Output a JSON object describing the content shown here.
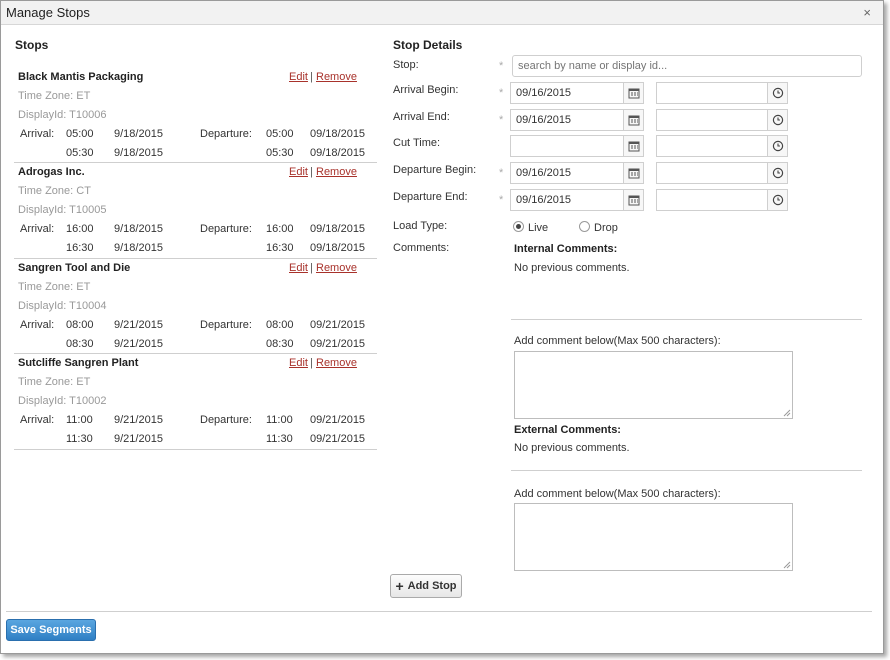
{
  "dialog": {
    "title": "Manage Stops",
    "close_glyph": "×"
  },
  "stops_panel": {
    "heading": "Stops",
    "edit_label": "Edit",
    "remove_label": "Remove",
    "separator": "|",
    "arrival_label": "Arrival:",
    "departure_label": "Departure:",
    "items": [
      {
        "name": "Black Mantis Packaging",
        "time_zone": "Time Zone: ET",
        "display_id": "DisplayId: T10006",
        "arr1_time": "05:00",
        "arr1_date": "9/18/2015",
        "dep1_time": "05:00",
        "dep1_date": "09/18/2015",
        "arr2_time": "05:30",
        "arr2_date": "9/18/2015",
        "dep2_time": "05:30",
        "dep2_date": "09/18/2015"
      },
      {
        "name": "Adrogas Inc.",
        "time_zone": "Time Zone: CT",
        "display_id": "DisplayId: T10005",
        "arr1_time": "16:00",
        "arr1_date": "9/18/2015",
        "dep1_time": "16:00",
        "dep1_date": "09/18/2015",
        "arr2_time": "16:30",
        "arr2_date": "9/18/2015",
        "dep2_time": "16:30",
        "dep2_date": "09/18/2015"
      },
      {
        "name": "Sangren Tool and Die",
        "time_zone": "Time Zone: ET",
        "display_id": "DisplayId: T10004",
        "arr1_time": "08:00",
        "arr1_date": "9/21/2015",
        "dep1_time": "08:00",
        "dep1_date": "09/21/2015",
        "arr2_time": "08:30",
        "arr2_date": "9/21/2015",
        "dep2_time": "08:30",
        "dep2_date": "09/21/2015"
      },
      {
        "name": "Sutcliffe Sangren Plant",
        "time_zone": "Time Zone: ET",
        "display_id": "DisplayId: T10002",
        "arr1_time": "11:00",
        "arr1_date": "9/21/2015",
        "dep1_time": "11:00",
        "dep1_date": "09/21/2015",
        "arr2_time": "11:30",
        "arr2_date": "9/21/2015",
        "dep2_time": "11:30",
        "dep2_date": "09/21/2015"
      }
    ]
  },
  "details": {
    "heading": "Stop Details",
    "required_mark": "*",
    "stop": {
      "label": "Stop:",
      "placeholder": "search by name or display id..."
    },
    "arrival_begin": {
      "label": "Arrival Begin:",
      "date": "09/16/2015",
      "time": ""
    },
    "arrival_end": {
      "label": "Arrival End:",
      "date": "09/16/2015",
      "time": ""
    },
    "cut_time": {
      "label": "Cut Time:",
      "date": "",
      "time": ""
    },
    "departure_begin": {
      "label": "Departure Begin:",
      "date": "09/16/2015",
      "time": ""
    },
    "departure_end": {
      "label": "Departure End:",
      "date": "09/16/2015",
      "time": ""
    },
    "load_type": {
      "label": "Load Type:",
      "options": [
        "Live",
        "Drop"
      ],
      "selected": "Live"
    },
    "comments": {
      "label": "Comments:",
      "internal_heading": "Internal Comments:",
      "internal_text": "No previous comments.",
      "internal_add_label": "Add comment below(Max 500 characters):",
      "external_heading": "External Comments:",
      "external_text": "No previous comments.",
      "external_add_label": "Add comment below(Max 500 characters):"
    }
  },
  "actions": {
    "add_stop": "Add Stop",
    "add_glyph": "+",
    "save_segments": "Save Segments"
  },
  "icons": {
    "calendar": "calendar-icon",
    "clock": "clock-icon"
  },
  "colors": {
    "link": "#a8322b",
    "primary_button": "#2f7fc4"
  }
}
